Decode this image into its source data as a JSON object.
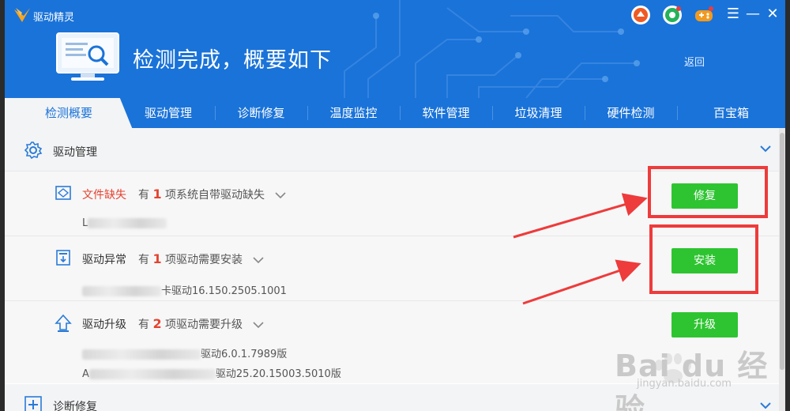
{
  "app": {
    "name": "驱动精灵"
  },
  "header": {
    "title": "检测完成，概要如下",
    "back_label": "返回"
  },
  "window_controls": [
    "☰",
    "—",
    "✕"
  ],
  "tabs": [
    {
      "label": "检测概要",
      "active": true
    },
    {
      "label": "驱动管理"
    },
    {
      "label": "诊断修复"
    },
    {
      "label": "温度监控"
    },
    {
      "label": "软件管理"
    },
    {
      "label": "垃圾清理"
    },
    {
      "label": "硬件检测"
    },
    {
      "label": "百宝箱"
    }
  ],
  "sections": {
    "driver": {
      "title": "驱动管理",
      "icon": "gear-icon"
    },
    "diagnose": {
      "title": "诊断修复",
      "icon": "plus-shield-icon"
    }
  },
  "rows": [
    {
      "label": "文件缺失",
      "prefix": "有",
      "count": "1",
      "suffix": "项系统自带驱动缺失",
      "button": "修复",
      "details": [
        {
          "lead": "L",
          "tail": ""
        }
      ]
    },
    {
      "label": "驱动异常",
      "prefix": "有",
      "count": "1",
      "suffix": "项驱动需要安装",
      "button": "安装",
      "details": [
        {
          "lead": "",
          "tail": "卡驱动16.150.2505.1001"
        }
      ]
    },
    {
      "label": "驱动升级",
      "prefix": "有",
      "count": "2",
      "suffix": "项驱动需要升级",
      "button": "升级",
      "details": [
        {
          "lead": "",
          "tail": "驱动6.0.1.7989版"
        },
        {
          "lead": "A",
          "tail": "驱动25.20.15003.5010版"
        }
      ]
    }
  ],
  "watermark": {
    "text": "Bai du 经验",
    "url": "jingyan.baidu.com"
  },
  "colors": {
    "header_blue": "#1a73d9",
    "button_green": "#2ec431",
    "alert_red": "#e4432f",
    "annotation_red": "#ee3b3b"
  }
}
